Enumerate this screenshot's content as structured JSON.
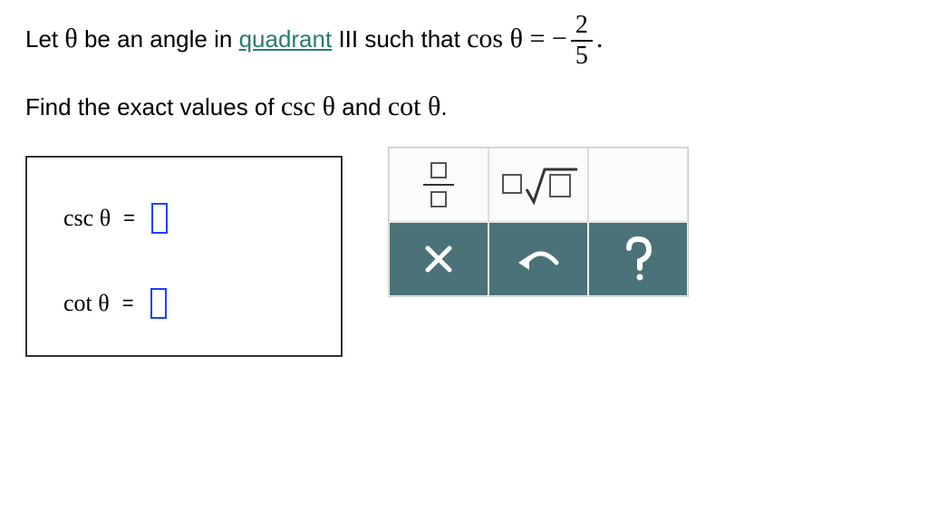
{
  "problem": {
    "line1_prefix": "Let ",
    "theta": "θ",
    "line1_mid": " be an angle in ",
    "quadrant_link": "quadrant",
    "quadrant_num": " III",
    "line1_after": " such that ",
    "equation_lhs": "cos θ",
    "equals": " = ",
    "minus": "−",
    "frac_num": "2",
    "frac_den": "5",
    "period": ".",
    "line2": "Find the exact values of ",
    "csc": "csc θ",
    "and": " and ",
    "cot": "cot θ",
    "line2_end": "."
  },
  "answers": {
    "csc_label": "csc θ",
    "cot_label": "cot θ",
    "eq": "="
  },
  "palette": {
    "fraction_tool": "fraction-template",
    "sqrt_tool": "sqrt-template",
    "clear": "clear",
    "undo": "undo",
    "help": "help"
  }
}
